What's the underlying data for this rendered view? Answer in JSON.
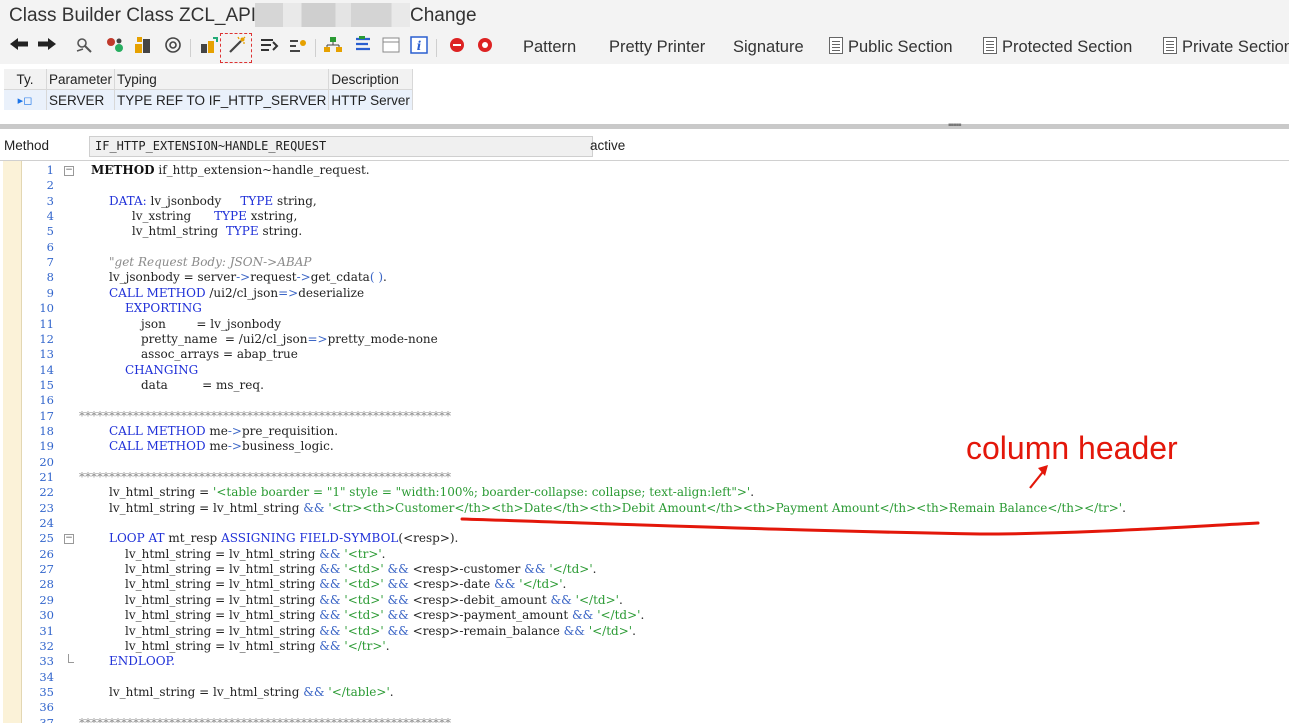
{
  "window": {
    "title_prefix": "Class Builder Class ZCL_API",
    "title_suffix": "Change"
  },
  "toolbar": {
    "back_icon": "arrow-left-icon",
    "forward_icon": "arrow-right-icon",
    "buttons": {
      "pattern": "Pattern",
      "pretty_printer": "Pretty Printer",
      "signature": "Signature",
      "public_section": "Public Section",
      "protected_section": "Protected Section",
      "private_section": "Private Section"
    }
  },
  "params": {
    "headers": [
      "Ty.",
      "Parameter",
      "Typing",
      "Description"
    ],
    "rows": [
      {
        "ty": "▸◻",
        "parameter": "SERVER",
        "typing": "TYPE REF TO IF_HTTP_SERVER",
        "description": "HTTP Server"
      }
    ]
  },
  "method": {
    "label": "Method",
    "name": "IF_HTTP_EXTENSION~HANDLE_REQUEST",
    "status": "active"
  },
  "editor": {
    "lines": [
      {
        "n": "1",
        "fold": "open"
      },
      {
        "n": "2"
      },
      {
        "n": "3"
      },
      {
        "n": "4"
      },
      {
        "n": "5"
      },
      {
        "n": "6"
      },
      {
        "n": "7"
      },
      {
        "n": "8"
      },
      {
        "n": "9"
      },
      {
        "n": "10"
      },
      {
        "n": "11"
      },
      {
        "n": "12"
      },
      {
        "n": "13"
      },
      {
        "n": "14"
      },
      {
        "n": "15"
      },
      {
        "n": "16"
      },
      {
        "n": "17"
      },
      {
        "n": "18"
      },
      {
        "n": "19"
      },
      {
        "n": "20"
      },
      {
        "n": "21"
      },
      {
        "n": "22"
      },
      {
        "n": "23"
      },
      {
        "n": "24"
      },
      {
        "n": "25",
        "fold": "open"
      },
      {
        "n": "26"
      },
      {
        "n": "27"
      },
      {
        "n": "28"
      },
      {
        "n": "29"
      },
      {
        "n": "30"
      },
      {
        "n": "31"
      },
      {
        "n": "32"
      },
      {
        "n": "33",
        "fold": "end"
      },
      {
        "n": "34"
      },
      {
        "n": "35"
      },
      {
        "n": "36"
      },
      {
        "n": "37"
      }
    ],
    "code": {
      "l1": [
        "METHOD",
        " if_http_extension~handle_request."
      ],
      "l3": [
        "DATA:",
        " lv_jsonbody     ",
        "TYPE",
        " string,"
      ],
      "l4": [
        "      lv_xstring      ",
        "TYPE",
        " xstring,"
      ],
      "l5": [
        "      lv_html_string  ",
        "TYPE",
        " string."
      ],
      "l7": "\"get Request Body: JSON->ABAP",
      "l8": [
        "lv_jsonbody = server",
        "->",
        "request",
        "->",
        "get_cdata",
        "( )",
        "."
      ],
      "l9": [
        "CALL METHOD",
        " /ui2/cl_json",
        "=>",
        "deserialize"
      ],
      "l10": "EXPORTING",
      "l11": [
        "json",
        "        = ",
        "lv_jsonbody"
      ],
      "l12": [
        "pretty_name  = /ui2/cl_json",
        "=>",
        "pretty_mode-none"
      ],
      "l13": [
        "assoc_arrays = abap_true"
      ],
      "l14": "CHANGING",
      "l15": [
        "data",
        "         = ",
        "ms_req."
      ],
      "stars": "**************************************************************",
      "l18": [
        "CALL METHOD",
        " me",
        "->",
        "pre_requisition."
      ],
      "l19": [
        "CALL METHOD",
        " me",
        "->",
        "business_logic."
      ],
      "l22": [
        "lv_html_string = ",
        "'<table boarder = \"1\" style = \"width:100%; boarder-collapse: collapse; text-align:left\">'",
        "."
      ],
      "l23": [
        "lv_html_string = lv_html_string ",
        "&&",
        " ",
        "'<tr><th>Customer</th><th>Date</th><th>Debit Amount</th><th>Payment Amount</th><th>Remain Balance</th></tr>'",
        "."
      ],
      "l25": [
        "LOOP AT",
        " mt_resp ",
        "ASSIGNING FIELD-SYMBOL",
        "(<resp>)."
      ],
      "l26": [
        "lv_html_string = lv_html_string ",
        "&&",
        " ",
        "'<tr>'",
        "."
      ],
      "l27": [
        "lv_html_string = lv_html_string ",
        "&&",
        " ",
        "'<td>'",
        " ",
        "&&",
        " <resp>-customer ",
        "&&",
        " ",
        "'</td>'",
        "."
      ],
      "l28": [
        "lv_html_string = lv_html_string ",
        "&&",
        " ",
        "'<td>'",
        " ",
        "&&",
        " <resp>-date ",
        "&&",
        " ",
        "'</td>'",
        "."
      ],
      "l29": [
        "lv_html_string = lv_html_string ",
        "&&",
        " ",
        "'<td>'",
        " ",
        "&&",
        " <resp>-debit_amount ",
        "&&",
        " ",
        "'</td>'",
        "."
      ],
      "l30": [
        "lv_html_string = lv_html_string ",
        "&&",
        " ",
        "'<td>'",
        " ",
        "&&",
        " <resp>-payment_amount ",
        "&&",
        " ",
        "'</td>'",
        "."
      ],
      "l31": [
        "lv_html_string = lv_html_string ",
        "&&",
        " ",
        "'<td>'",
        " ",
        "&&",
        " <resp>-remain_balance ",
        "&&",
        " ",
        "'</td>'",
        "."
      ],
      "l32": [
        "lv_html_string = lv_html_string ",
        "&&",
        " ",
        "'</tr>'",
        "."
      ],
      "l33": "ENDLOOP.",
      "l35": [
        "lv_html_string = lv_html_string ",
        "&&",
        " ",
        "'</table>'",
        "."
      ]
    }
  },
  "annotation": {
    "label": "column header",
    "color": "#e3170a"
  }
}
